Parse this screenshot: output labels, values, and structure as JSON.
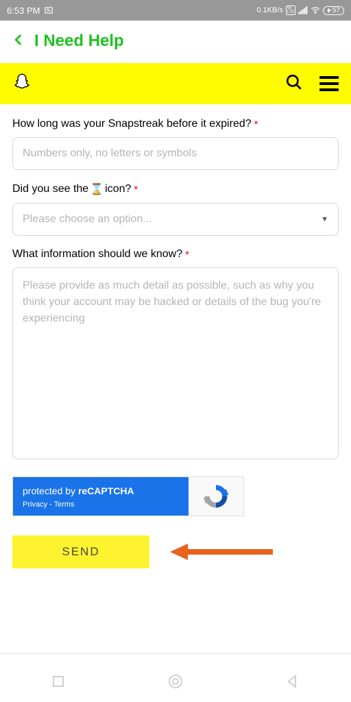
{
  "status": {
    "time": "6:53 PM",
    "speed": "0.1KB/s",
    "volte": "Vo LTE",
    "battery": "57"
  },
  "nav": {
    "title": "I Need Help"
  },
  "form": {
    "q1": {
      "label": "How long was your Snapstreak before it expired?",
      "placeholder": "Numbers only, no letters or symbols"
    },
    "q2": {
      "label_pre": "Did you see the ",
      "label_icon": "⌛",
      "label_post": " icon?",
      "placeholder": "Please choose an option..."
    },
    "q3": {
      "label": "What information should we know?",
      "placeholder": "Please provide as much detail as possible, such as why you think your account may be hacked or details of the bug you're experiencing"
    }
  },
  "recaptcha": {
    "prefix": "protected by ",
    "brand": "reCAPTCHA",
    "privacy": "Privacy",
    "terms": "Terms",
    "sep": " - "
  },
  "send_label": "SEND"
}
